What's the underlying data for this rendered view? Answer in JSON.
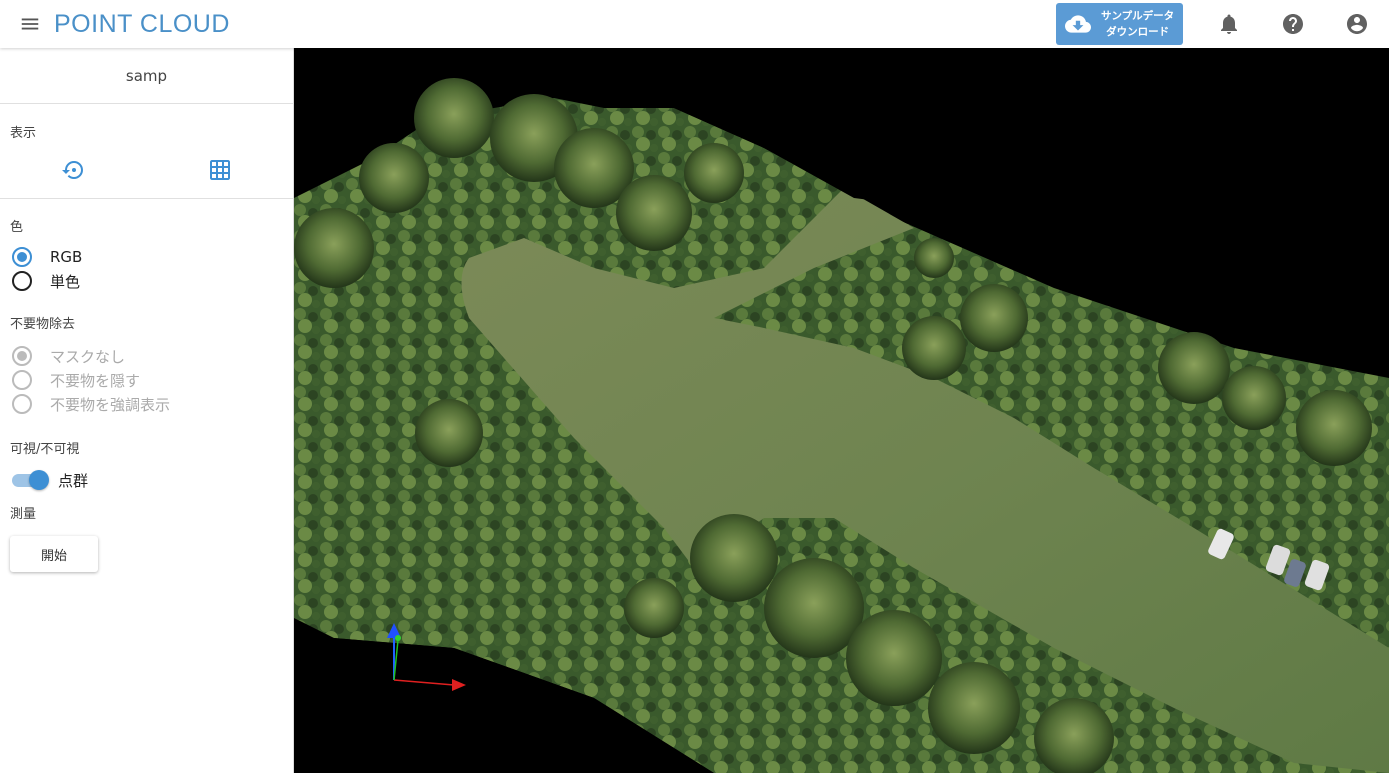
{
  "header": {
    "title": "POINT CLOUD",
    "download_button": {
      "line1": "サンプルデータ",
      "line2": "ダウンロード"
    },
    "icons": [
      "menu-icon",
      "cloud-download-icon",
      "bell-icon",
      "help-icon",
      "account-icon"
    ]
  },
  "sidebar": {
    "file_name": "samp",
    "display": {
      "label": "表示",
      "icons": [
        "reset-view-icon",
        "grid-icon"
      ]
    },
    "color": {
      "label": "色",
      "options": [
        {
          "label": "RGB",
          "selected": true
        },
        {
          "label": "単色",
          "selected": false
        }
      ]
    },
    "removal": {
      "label": "不要物除去",
      "options": [
        {
          "label": "マスクなし",
          "selected": true,
          "disabled": true
        },
        {
          "label": "不要物を隠す",
          "selected": false,
          "disabled": true
        },
        {
          "label": "不要物を強調表示",
          "selected": false,
          "disabled": true
        }
      ]
    },
    "visibility": {
      "label": "可視/不可視",
      "toggle_label": "点群",
      "toggle_on": true
    },
    "measure": {
      "label": "測量",
      "start_label": "開始"
    }
  },
  "colors": {
    "accent": "#3d8fd4",
    "title": "#4a90c8",
    "download_bg": "#5b9bd5",
    "viewport_bg": "#000000"
  }
}
